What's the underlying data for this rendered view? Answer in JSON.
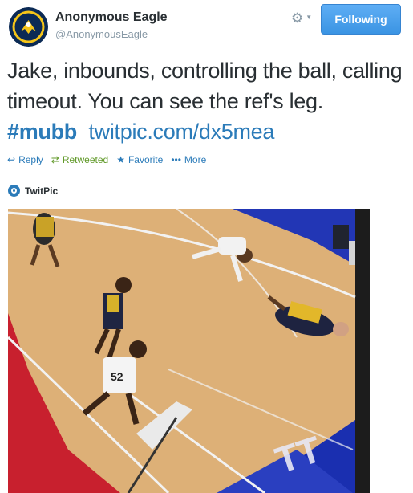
{
  "user": {
    "name": "Anonymous Eagle",
    "handle": "@AnonymousEagle"
  },
  "header": {
    "follow_label": "Following",
    "gear_icon": "gear-icon",
    "caret_icon": "chevron-down-icon"
  },
  "tweet": {
    "text_part1": "Jake, inbounds, controlling the ball, calling timeout. You can see the ref's leg. ",
    "hashtag": "#mubb",
    "link": "twitpic.com/dx5mea"
  },
  "actions": {
    "reply_label": "Reply",
    "retweet_label": "Retweeted",
    "favorite_label": "Favorite",
    "more_label": "More"
  },
  "card": {
    "provider": "TwitPic"
  },
  "colors": {
    "link": "#2b7bb9",
    "retweeted": "#609928",
    "follow_button": "#3b94e3"
  }
}
